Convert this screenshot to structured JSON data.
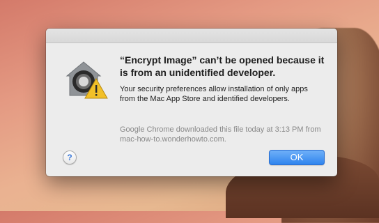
{
  "dialog": {
    "heading": "“Encrypt Image” can’t be opened because it is from an unidentified developer.",
    "body": "Your security preferences allow installation of only apps from the Mac App Store and identified developers.",
    "info": "Google Chrome downloaded this file today at 3:13 PM from mac-how-to.wonderhowto.com.",
    "help_label": "?",
    "ok_label": "OK",
    "icon": "gatekeeper-warning-icon"
  },
  "colors": {
    "accent": "#2f84ee",
    "warning": "#f2c028"
  }
}
